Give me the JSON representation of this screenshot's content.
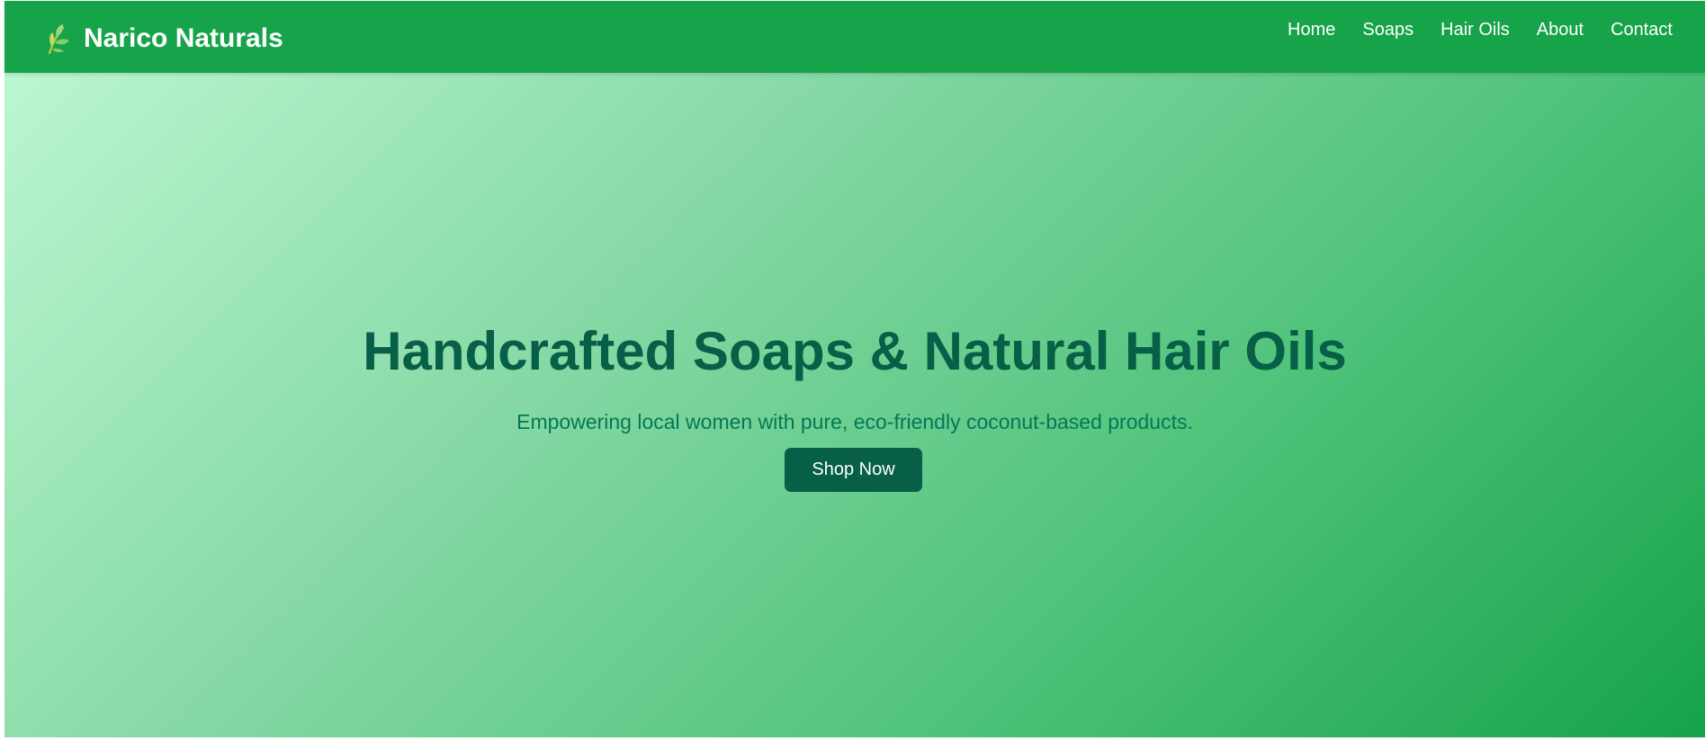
{
  "brand": {
    "name": "Narico Naturals",
    "icon": "leaf-sprout-icon"
  },
  "nav": {
    "items": [
      {
        "label": "Home"
      },
      {
        "label": "Soaps"
      },
      {
        "label": "Hair Oils"
      },
      {
        "label": "About"
      },
      {
        "label": "Contact"
      }
    ]
  },
  "hero": {
    "title": "Handcrafted Soaps & Natural Hair Oils",
    "subtitle": "Empowering local women with pure, eco-friendly coconut-based products.",
    "cta_label": "Shop Now"
  },
  "colors": {
    "navbar": "#16a34a",
    "hero_gradient_start": "#bbf7d0",
    "hero_gradient_end": "#16a34a",
    "title_text": "#065f46",
    "subtitle_text": "#047857",
    "button_bg": "#065f46",
    "button_text": "#ffffff"
  }
}
